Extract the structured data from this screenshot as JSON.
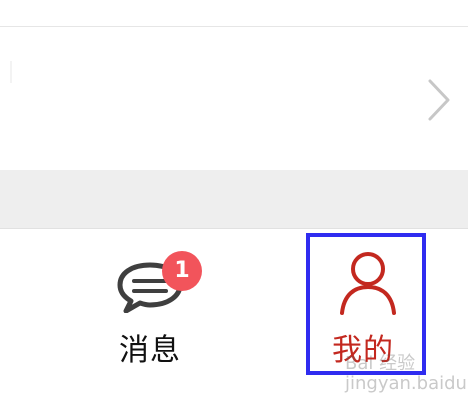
{
  "tabs": {
    "messages": {
      "label": "消息",
      "icon": "chat-bubble-icon",
      "badge": "1"
    },
    "mine": {
      "label": "我的",
      "icon": "user-icon"
    }
  },
  "colors": {
    "active": "#c3281f",
    "inactive": "#111111",
    "badge": "#f2545b",
    "highlight": "#2f2cf0",
    "band": "#eeeeee"
  },
  "watermark": {
    "line1": "Bai 经验",
    "line2": "jingyan.baidu.com"
  }
}
